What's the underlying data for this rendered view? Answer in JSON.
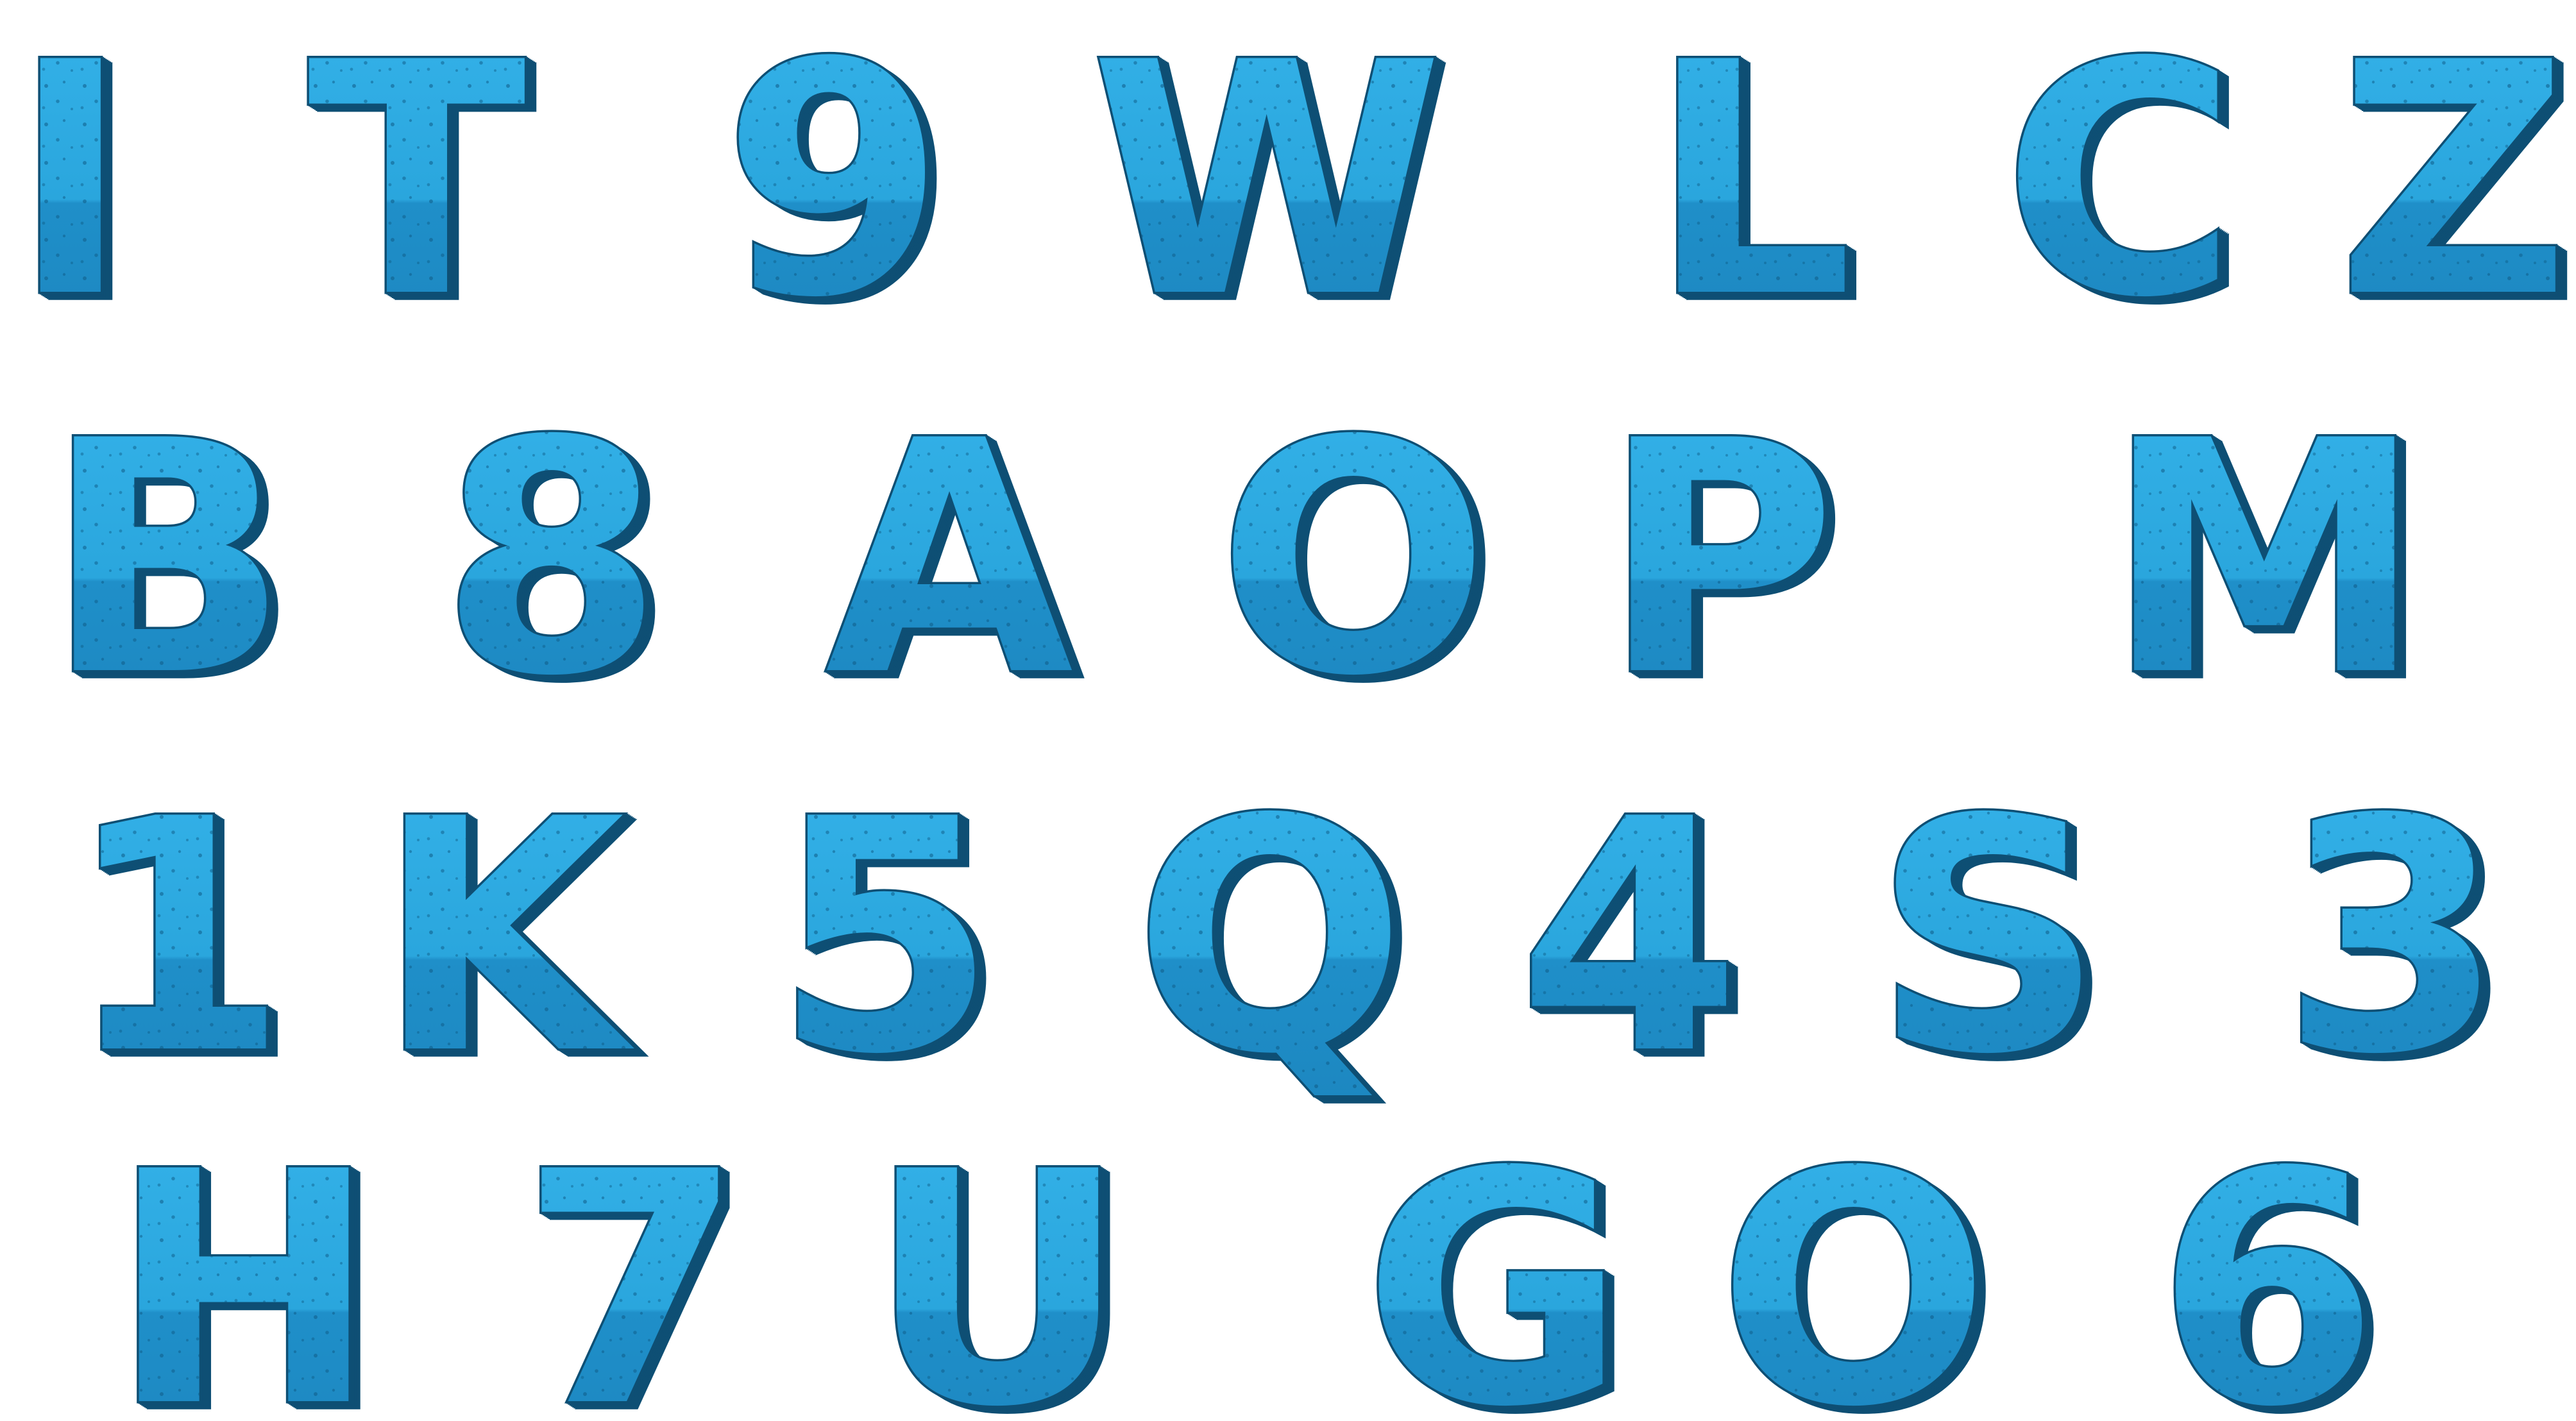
{
  "colors": {
    "background": "#ffffff",
    "glyph_face": "#2aa6dd",
    "glyph_face_lower": "#1f8fc9",
    "glyph_side": "#146b9a",
    "glyph_outline": "#0e4f74",
    "glyph_crack": "#0b4366"
  },
  "rows": [
    {
      "glyphs": [
        "I",
        "T",
        "9",
        "W",
        "L",
        "C",
        "Z"
      ]
    },
    {
      "glyphs": [
        "B",
        "8",
        "A",
        "O",
        "P",
        "M"
      ]
    },
    {
      "glyphs": [
        "1",
        "K",
        "5",
        "Q",
        "4",
        "S",
        "3"
      ]
    },
    {
      "glyphs": [
        "H",
        "7",
        "U",
        "G",
        "O",
        "6"
      ]
    }
  ]
}
